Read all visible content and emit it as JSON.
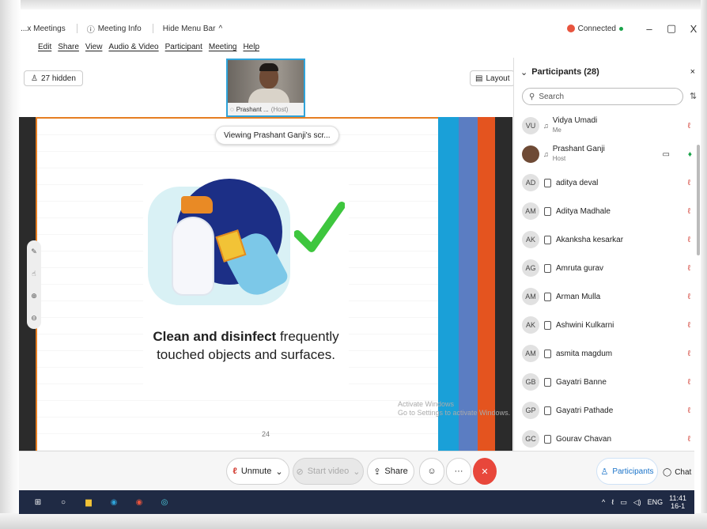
{
  "titlebar": {
    "app_title": "...x Meetings",
    "meeting_info": "Meeting Info",
    "hide_menu": "Hide Menu Bar",
    "connection": "Connected",
    "minimize": "–",
    "restore": "▢",
    "close": "X"
  },
  "menubar": [
    "Edit",
    "Share",
    "View",
    "Audio & Video",
    "Participant",
    "Meeting",
    "Help"
  ],
  "hidden_count": "27 hidden",
  "host_thumb": {
    "name": "Prashant ...",
    "role": "(Host)"
  },
  "layout_label": "Layout",
  "viewing_label": "Viewing Prashant Ganji's scr...",
  "slide": {
    "caption_bold": "Clean and disinfect",
    "caption_rest": " frequently touched objects and surfaces.",
    "watermark_line1": "Activate Windows",
    "watermark_line2": "Go to Settings to activate Windows.",
    "page_number": "24"
  },
  "toolbar": {
    "unmute": "Unmute",
    "start_video": "Start video",
    "share": "Share",
    "more": "···",
    "end": "✕",
    "participants": "Participants",
    "chat": "Chat"
  },
  "panel": {
    "title": "Participants (28)",
    "close": "×",
    "search_placeholder": "Search",
    "participants": [
      {
        "initials": "VU",
        "name": "Vidya Umadi",
        "sub": "Me"
      },
      {
        "initials": "",
        "name": "Prashant Ganji",
        "sub": "Host"
      },
      {
        "initials": "AD",
        "name": "aditya deval",
        "sub": ""
      },
      {
        "initials": "AM",
        "name": "Aditya Madhale",
        "sub": ""
      },
      {
        "initials": "AK",
        "name": "Akanksha kesarkar",
        "sub": ""
      },
      {
        "initials": "AG",
        "name": "Amruta gurav",
        "sub": ""
      },
      {
        "initials": "AM",
        "name": "Arman Mulla",
        "sub": ""
      },
      {
        "initials": "AK",
        "name": "Ashwini Kulkarni",
        "sub": ""
      },
      {
        "initials": "AM",
        "name": "asmita magdum",
        "sub": ""
      },
      {
        "initials": "GB",
        "name": "Gayatri Banne",
        "sub": ""
      },
      {
        "initials": "GP",
        "name": "Gayatri Pathade",
        "sub": ""
      },
      {
        "initials": "GC",
        "name": "Gourav Chavan",
        "sub": ""
      }
    ]
  },
  "taskbar": {
    "language": "ENG",
    "time": "11:41",
    "date": "16-1"
  },
  "colors": {
    "accent_blue": "#2fa3d9",
    "end_red": "#e8473b",
    "mute_red": "#d23a2f",
    "taskbar": "#1f2a44"
  }
}
